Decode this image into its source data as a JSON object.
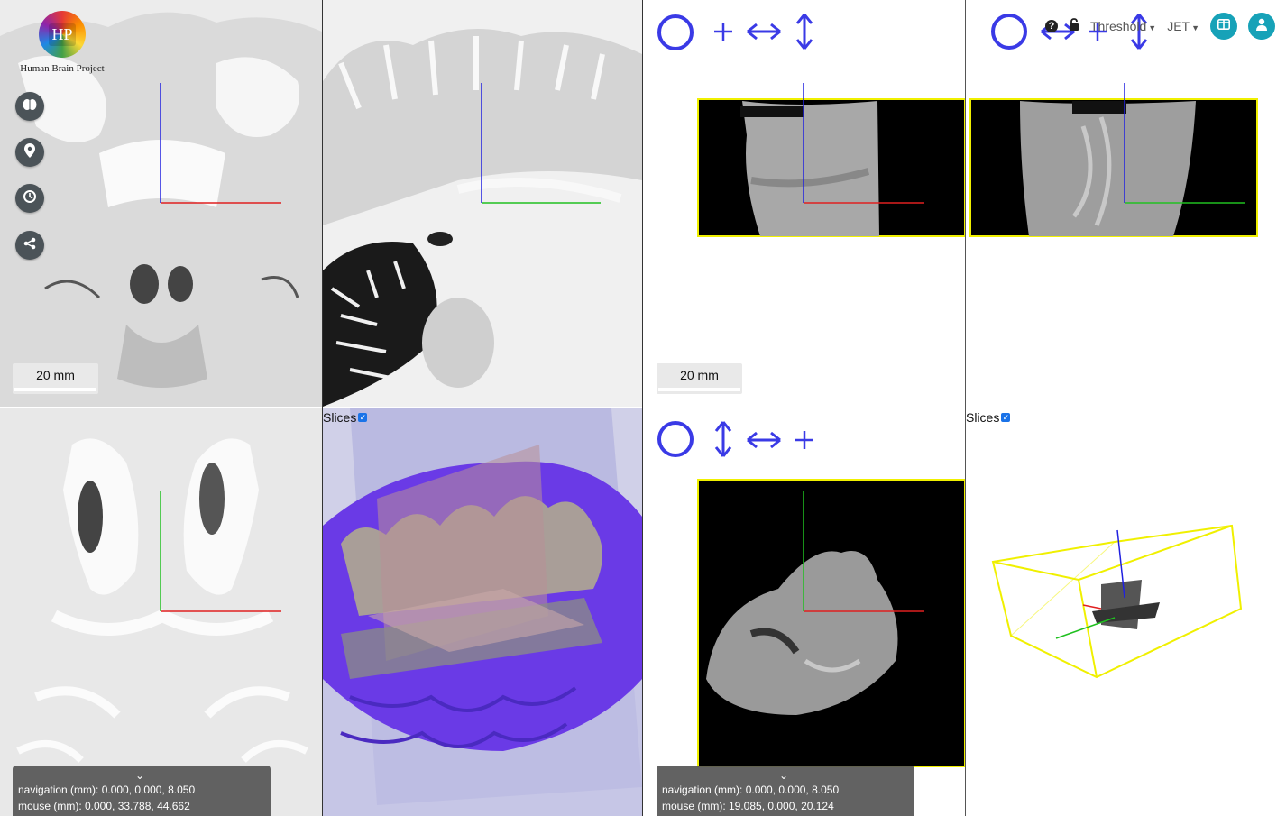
{
  "logo": {
    "initials": "HP",
    "caption": "Human Brain Project"
  },
  "sidebar": {
    "items": [
      {
        "name": "brain-atlas",
        "icon": "brain-icon"
      },
      {
        "name": "location",
        "icon": "map-pin-icon"
      },
      {
        "name": "history",
        "icon": "history-icon"
      },
      {
        "name": "share",
        "icon": "share-icon"
      }
    ]
  },
  "panels": {
    "top_left": {
      "scale_label": "20 mm"
    },
    "top_right_left": {
      "scale_label": "20 mm"
    },
    "bottom_left": {
      "navigation": "navigation (mm): 0.000, 0.000, 8.050",
      "mouse": "mouse (mm): 0.000, 33.788, 44.662"
    },
    "bottom_mid": {
      "slices_label": "Slices"
    },
    "bottom_right_left": {
      "navigation": "navigation (mm): 0.000, 0.000, 8.050",
      "mouse": "mouse (mm): 19.085, 0.000, 20.124"
    },
    "bottom_right": {
      "slices_label": "Slices"
    }
  },
  "toolbar": {
    "threshold_label": "Threshold",
    "colormap_label": "JET"
  },
  "colors": {
    "axis_red": "#e02020",
    "axis_green": "#20c020",
    "axis_blue": "#2020e0",
    "glyph_blue": "#3a3ae6",
    "teal": "#17a2b8",
    "bbox_yellow": "#f0f000",
    "brain_purple": "#6a3ae6"
  }
}
